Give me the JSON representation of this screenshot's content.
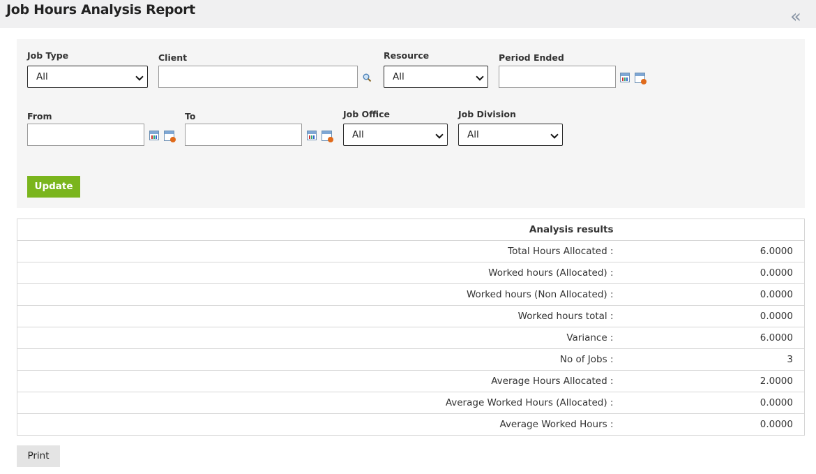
{
  "page": {
    "title": "Job Hours Analysis Report"
  },
  "filters": {
    "job_type": {
      "label": "Job Type",
      "value": "All"
    },
    "client": {
      "label": "Client",
      "value": ""
    },
    "resource": {
      "label": "Resource",
      "value": "All"
    },
    "period_ended": {
      "label": "Period Ended",
      "value": ""
    },
    "from": {
      "label": "From",
      "value": ""
    },
    "to": {
      "label": "To",
      "value": ""
    },
    "job_office": {
      "label": "Job Office",
      "value": "All"
    },
    "job_division": {
      "label": "Job Division",
      "value": "All"
    },
    "update_label": "Update"
  },
  "results": {
    "header": "Analysis results",
    "rows": [
      {
        "label": "Total Hours Allocated :",
        "value": "6.0000"
      },
      {
        "label": "Worked hours (Allocated) :",
        "value": "0.0000"
      },
      {
        "label": "Worked hours (Non Allocated) :",
        "value": "0.0000"
      },
      {
        "label": "Worked hours total :",
        "value": "0.0000"
      },
      {
        "label": "Variance :",
        "value": "6.0000"
      },
      {
        "label": "No of Jobs :",
        "value": "3"
      },
      {
        "label": "Average Hours Allocated :",
        "value": "2.0000"
      },
      {
        "label": "Average Worked Hours (Allocated) :",
        "value": "0.0000"
      },
      {
        "label": "Average Worked Hours :",
        "value": "0.0000"
      }
    ]
  },
  "print_label": "Print",
  "colors": {
    "accent": "#7ab51d",
    "panel_bg": "#f5f5f5",
    "topbar_bg": "#f0f0f1"
  }
}
